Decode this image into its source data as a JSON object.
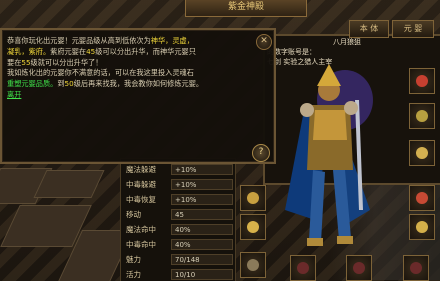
{
  "window": {
    "title": "紫金神殿"
  },
  "dialog": {
    "line1a": "恭喜你玩化出元婴！元婴品级从高到低依次为",
    "line1b": "神华，灵虚，",
    "line2a": "凝乳，紫府。",
    "line2b": "紫府元婴在",
    "line2c": "45",
    "line2d": "级可以分出升华，而神华元婴只",
    "line3a": "要在",
    "line3b": "55",
    "line3c": "级就可以分出升华了！",
    "line4": "我如炼化出的元婴你不满意的话，可以在我这里投入灵魂石",
    "line5a": "重塑元婴品质。",
    "line5b": "到",
    "line5c": "50",
    "line5d": "级后再来找我，我会教你如何修炼元婴。",
    "leave_link": "离开",
    "close_label": "✕",
    "help_label": "?"
  },
  "panel": {
    "tab_body": "本 体",
    "tab_yuanying": "元 婴",
    "head_line1": "八月狼狙",
    "head_line2": "的数字账号是：",
    "head_line3": "七剑 实验之猎人主宰"
  },
  "stats": [
    {
      "label": "魔法躲避",
      "value": "+10%"
    },
    {
      "label": "中毒躲避",
      "value": "+10%"
    },
    {
      "label": "中毒恢复",
      "value": "+10%"
    },
    {
      "label": "移动",
      "value": "45"
    },
    {
      "label": "魔法命中",
      "value": "40%"
    },
    {
      "label": "中毒命中",
      "value": "40%"
    },
    {
      "label": "魅力",
      "value": "70/148"
    },
    {
      "label": "活力",
      "value": "10/10"
    }
  ],
  "colors": {
    "highlight_yellow": "#f2d83a",
    "highlight_green": "#3fe24a",
    "frame": "#6b5534"
  }
}
